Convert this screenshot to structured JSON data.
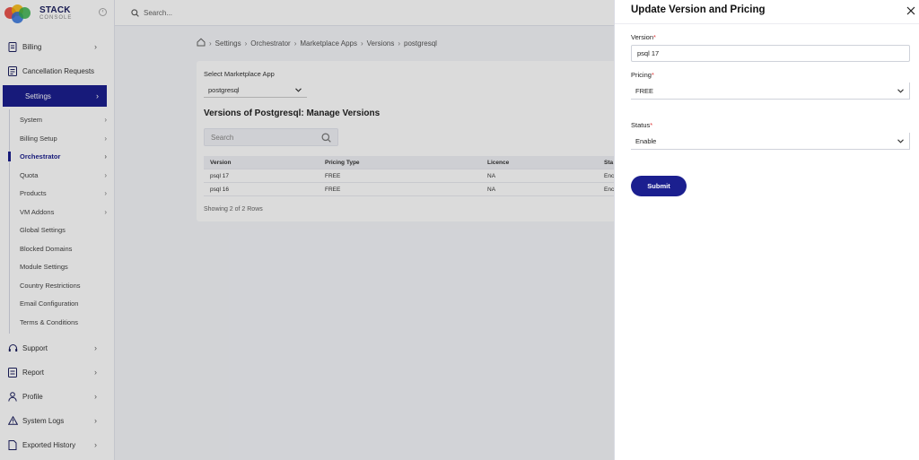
{
  "brand": {
    "name": "STACK",
    "sub": "CONSOLE"
  },
  "sidebar": {
    "items": [
      {
        "label": "Billing",
        "icon": "receipt-icon"
      },
      {
        "label": "Cancellation Requests",
        "icon": "document-icon"
      },
      {
        "label": "Settings",
        "icon": "gear-icon"
      },
      {
        "label": "Support",
        "icon": "headset-icon"
      },
      {
        "label": "Report",
        "icon": "report-icon"
      },
      {
        "label": "Profile",
        "icon": "user-icon"
      },
      {
        "label": "System Logs",
        "icon": "warning-icon"
      },
      {
        "label": "Exported History",
        "icon": "file-icon"
      }
    ],
    "settings_sub": [
      {
        "label": "System",
        "chevron": true
      },
      {
        "label": "Billing Setup",
        "chevron": true
      },
      {
        "label": "Orchestrator",
        "chevron": true
      },
      {
        "label": "Quota",
        "chevron": true
      },
      {
        "label": "Products",
        "chevron": true
      },
      {
        "label": "VM Addons",
        "chevron": true
      },
      {
        "label": "Global Settings",
        "chevron": false
      },
      {
        "label": "Blocked Domains",
        "chevron": false
      },
      {
        "label": "Module Settings",
        "chevron": false
      },
      {
        "label": "Country Restrictions",
        "chevron": false
      },
      {
        "label": "Email Configuration",
        "chevron": false
      },
      {
        "label": "Terms & Conditions",
        "chevron": false
      }
    ]
  },
  "topbar": {
    "search_placeholder": "Search..."
  },
  "breadcrumb": [
    "Settings",
    "Orchestrator",
    "Marketplace Apps",
    "Versions",
    "postgresql"
  ],
  "main": {
    "select_label": "Select Marketplace App",
    "select_value": "postgresql",
    "title": "Versions of Postgresql: Manage Versions",
    "search_placeholder": "Search",
    "table": {
      "columns": [
        "Version",
        "Pricing Type",
        "Licence",
        "Sta"
      ],
      "rows": [
        [
          "psql 17",
          "FREE",
          "NA",
          "Enc"
        ],
        [
          "psql 16",
          "FREE",
          "NA",
          "Enc"
        ]
      ]
    },
    "showing": "Showing 2 of 2 Rows"
  },
  "drawer": {
    "title": "Update Version and Pricing",
    "version_label": "Version",
    "version_value": "psql 17",
    "pricing_label": "Pricing",
    "pricing_value": "FREE",
    "status_label": "Status",
    "status_value": "Enable",
    "required_mark": "*",
    "submit_label": "Submit"
  },
  "colors": {
    "primary": "#1b1f8f",
    "required": "#e03b3b"
  }
}
